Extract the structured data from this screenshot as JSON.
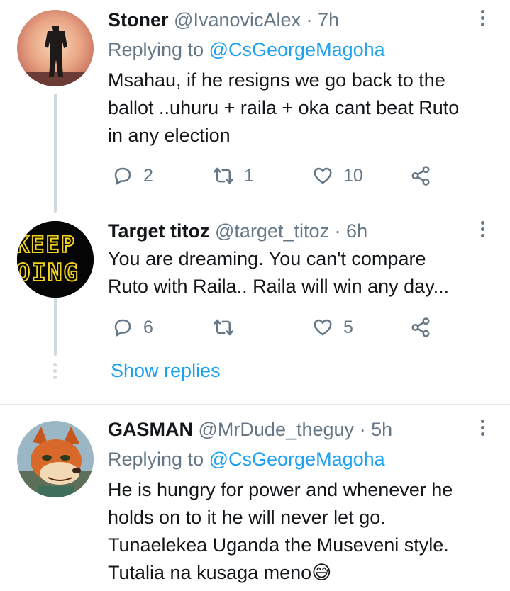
{
  "tweets": [
    {
      "name": "Stoner",
      "handle": "@IvanovicAlex",
      "dot": "·",
      "time": "7h",
      "replying_prefix": "Replying to",
      "replying_to": "@CsGeorgeMagoha",
      "lines": [
        "Msahau, if he resigns we go back to the",
        "ballot ..uhuru + raila + oka cant beat Ruto",
        "in any election"
      ],
      "replies": "2",
      "retweets": "1",
      "likes": "10"
    },
    {
      "name": "Target titoz",
      "handle": "@target_titoz",
      "dot": "·",
      "time": "6h",
      "lines": [
        "You are dreaming. You can't compare",
        "Ruto with Raila.. Raila will win any day..."
      ],
      "replies": "6",
      "retweets": "",
      "likes": "5",
      "avatar_text_top": "KEEP",
      "avatar_text_bottom": "OING"
    },
    {
      "name": "GASMAN",
      "handle": "@MrDude_theguy",
      "dot": "·",
      "time": "5h",
      "replying_prefix": "Replying to",
      "replying_to": "@CsGeorgeMagoha",
      "lines": [
        "He is hungry for power and whenever he",
        "holds on to it he will never let go.",
        "Tunaelekea Uganda the Museveni style.",
        "Tutalia na kusaga meno"
      ],
      "emoji": "😅"
    }
  ],
  "show_replies": "Show replies",
  "colors": {
    "accent": "#1da1f2",
    "secondary": "#657786",
    "text": "#14171a",
    "line": "#cfd9de"
  },
  "icons": [
    "reply-icon",
    "retweet-icon",
    "like-icon",
    "share-icon",
    "more-icon"
  ]
}
